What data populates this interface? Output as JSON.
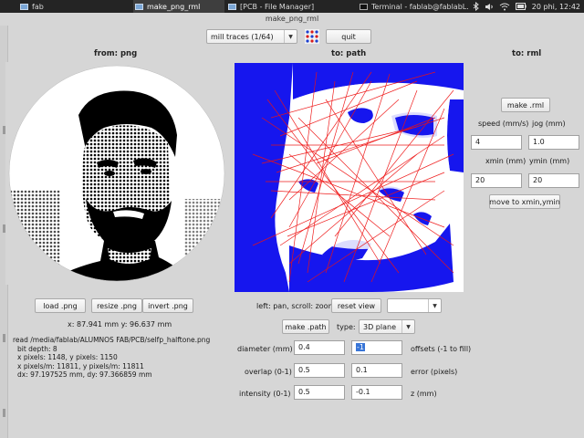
{
  "taskbar": {
    "items": [
      {
        "label": "fab",
        "active": false
      },
      {
        "label": "make_png_rml",
        "active": true
      },
      {
        "label": "[PCB - File Manager]",
        "active": false
      },
      {
        "label": "Terminal - fablab@fablabL...",
        "active": false
      }
    ],
    "clock": "20 phi, 12:42"
  },
  "window": {
    "title": "make_png_rml"
  },
  "toolbar": {
    "process_select": "mill traces (1/64)",
    "quit_label": "quit"
  },
  "from_panel": {
    "header": "from: png",
    "load_label": "load .png",
    "resize_label": "resize .png",
    "invert_label": "invert .png",
    "coords": "x: 87.941 mm  y: 96.637 mm",
    "info": {
      "read": "read /media/fablab/ALUMNOS FAB/PCB/selfp_halftone.png",
      "bit_depth": "bit depth: 8",
      "pixels": "x pixels: 1148, y pixels: 1150",
      "pixels_per_m": "x pixels/m: 11811, y pixels/m: 11811",
      "dx_dy": "dx: 97.197525 mm, dy: 97.366859 mm"
    }
  },
  "path_panel": {
    "header": "to: path",
    "hint": "left: pan, scroll: zoom",
    "reset_view_label": "reset view",
    "view_select": "",
    "make_path_label": "make .path",
    "type_label": "type:",
    "type_select": "3D plane",
    "params": {
      "diameter_label": "diameter (mm)",
      "diameter_value": "0.4",
      "offsets_value": "-1",
      "offsets_label": "offsets (-1 to fill)",
      "overlap_label": "overlap (0-1)",
      "overlap_value": "0.5",
      "error_value": "0.1",
      "error_label": "error (pixels)",
      "intensity_label": "intensity (0-1)",
      "intensity_value": "0.5",
      "z_value": "-0.1",
      "z_label": "z (mm)"
    }
  },
  "rml_panel": {
    "header": "to: rml",
    "make_rml_label": "make .rml",
    "speed_label": "speed (mm/s)",
    "speed_value": "4",
    "jog_label": "jog (mm)",
    "jog_value": "1.0",
    "xmin_label": "xmin (mm)",
    "xmin_value": "20",
    "ymin_label": "ymin (mm)",
    "ymin_value": "20",
    "move_label": "move to xmin,ymin"
  },
  "colors": {
    "toolpath_blue": "#1616ee",
    "toolpath_red": "#ee1111",
    "taskbar_bg": "#242424",
    "window_bg": "#d6d6d6"
  }
}
